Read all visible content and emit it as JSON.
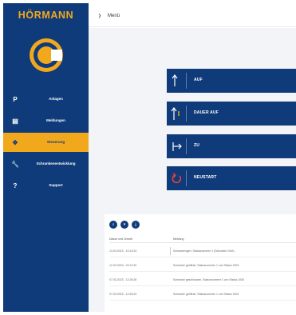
{
  "brand": {
    "name": "HÖRMANN"
  },
  "sidebar": {
    "items": [
      {
        "icon": "P",
        "icon_name": "parking-p-icon",
        "label": "Anlagen"
      },
      {
        "icon": "▤",
        "icon_name": "list-icon",
        "label": "Meldungen"
      },
      {
        "icon": "✥",
        "icon_name": "control-cross-icon",
        "label": "Steuerung",
        "active": true
      },
      {
        "icon": "🔧",
        "icon_name": "wrench-icon",
        "label": "Schrankenentwicklung"
      },
      {
        "icon": "?",
        "icon_name": "support-icon",
        "label": "Support"
      }
    ]
  },
  "header": {
    "menu_label": "Menü"
  },
  "controls": [
    {
      "label": "AUF",
      "icon_name": "open-arrow-icon"
    },
    {
      "label": "DAUER AUF",
      "icon_name": "permanent-open-icon"
    },
    {
      "label": "ZU",
      "icon_name": "close-arrow-icon"
    },
    {
      "label": "NEUSTART",
      "icon_name": "restart-icon"
    }
  ],
  "log": {
    "columns": [
      "Datum und Uhrzeit",
      "Meldung"
    ],
    "rows": [
      {
        "date": "13.03.2023 - 10:13:24",
        "message": "Schrankengen. Statusnummer 1 (Schranke Geöf..."
      },
      {
        "date": "12.03.2023 - 02:13:20",
        "message": "Schranke geöffnet, Statusnummer 1 von Status 1003"
      },
      {
        "date": "07.03.2023 - 12:26:26",
        "message": "Schranke geschlossen, Statusnummer 1 von Status 1000"
      },
      {
        "date": "07.03.2023 - 12:26:23",
        "message": "Schranke geöffnet, Statusnummer 1 von Status 1003"
      }
    ]
  },
  "colors": {
    "navy": "#103b7a",
    "accent": "#f2a81d",
    "background": "#f2f4f7",
    "restart_red": "#e0403a"
  }
}
